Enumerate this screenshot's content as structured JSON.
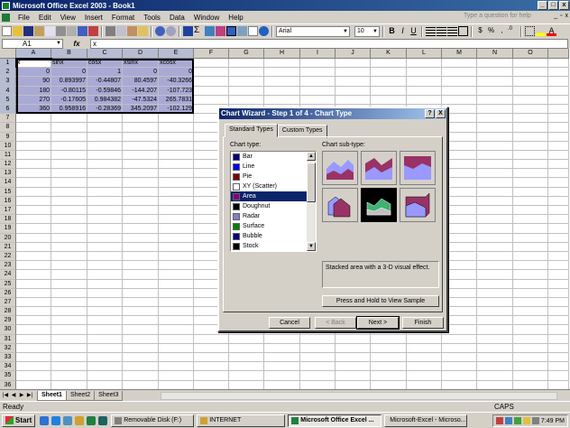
{
  "window": {
    "title": "Microsoft Office Excel 2003 - Book1"
  },
  "menu": [
    "File",
    "Edit",
    "View",
    "Insert",
    "Format",
    "Tools",
    "Data",
    "Window",
    "Help"
  ],
  "help_placeholder": "Type a question for help",
  "toolbar": {
    "font": "Arial",
    "size": "10"
  },
  "formula": {
    "cell_ref": "A1",
    "fx": "fx",
    "content": "x"
  },
  "grid": {
    "columns": [
      "A",
      "B",
      "C",
      "D",
      "E",
      "F",
      "G",
      "H",
      "I",
      "J",
      "K",
      "L",
      "M",
      "N",
      "O"
    ],
    "rows": [
      "1",
      "2",
      "3",
      "4",
      "5",
      "6",
      "7",
      "8",
      "9",
      "10",
      "11",
      "12",
      "13",
      "14",
      "15",
      "16",
      "17",
      "18",
      "19",
      "20",
      "21",
      "22",
      "23",
      "24",
      "25",
      "26",
      "27",
      "28",
      "29",
      "30",
      "31",
      "32",
      "33",
      "34",
      "35",
      "36"
    ],
    "headers": [
      "x",
      "sinx",
      "cosx",
      "xsinx",
      "xcosx"
    ],
    "data": [
      [
        "0",
        "0",
        "1",
        "0",
        "0"
      ],
      [
        "90",
        "0.893997",
        "-0.44807",
        "80.4597",
        "-40.3266"
      ],
      [
        "180",
        "-0.80115",
        "-0.59846",
        "-144.207",
        "-107.723"
      ],
      [
        "270",
        "-0.17605",
        "0.984382",
        "-47.5324",
        "265.7831"
      ],
      [
        "360",
        "0.958916",
        "-0.28369",
        "345.2097",
        "-102.129"
      ]
    ]
  },
  "sheets": [
    "Sheet1",
    "Sheet2",
    "Sheet3"
  ],
  "status": {
    "left": "Ready",
    "caps": "CAPS"
  },
  "taskbar": {
    "start": "Start",
    "buttons": [
      "Removable Disk (F:)",
      "INTERNET",
      "Microsoft Office Excel ...",
      "Microsoft-Excel - Microso..."
    ],
    "clock": "7:49 PM"
  },
  "dialog": {
    "title": "Chart Wizard - Step 1 of 4 - Chart Type",
    "help_btn": "?",
    "close_btn": "X",
    "tabs": [
      "Standard Types",
      "Custom Types"
    ],
    "chart_type_label": "Chart type:",
    "chart_subtype_label": "Chart sub-type:",
    "chart_types": [
      {
        "label": "Bar",
        "icon": "bar-chart-icon",
        "color": "#000080"
      },
      {
        "label": "Line",
        "icon": "line-chart-icon",
        "color": "#0000ff"
      },
      {
        "label": "Pie",
        "icon": "pie-chart-icon",
        "color": "#800000"
      },
      {
        "label": "XY (Scatter)",
        "icon": "scatter-chart-icon",
        "color": "#ffffff"
      },
      {
        "label": "Area",
        "icon": "area-chart-icon",
        "color": "#800080"
      },
      {
        "label": "Doughnut",
        "icon": "doughnut-chart-icon",
        "color": "#000000"
      },
      {
        "label": "Radar",
        "icon": "radar-chart-icon",
        "color": "#8080c0"
      },
      {
        "label": "Surface",
        "icon": "surface-chart-icon",
        "color": "#008000"
      },
      {
        "label": "Bubble",
        "icon": "bubble-chart-icon",
        "color": "#000080"
      },
      {
        "label": "Stock",
        "icon": "stock-chart-icon",
        "color": "#000000"
      }
    ],
    "selected_type": "Area",
    "description": "Stacked area with a 3-D visual effect.",
    "press_hold": "Press and Hold to View Sample",
    "buttons": {
      "cancel": "Cancel",
      "back": "< Back",
      "next": "Next >",
      "finish": "Finish"
    }
  }
}
